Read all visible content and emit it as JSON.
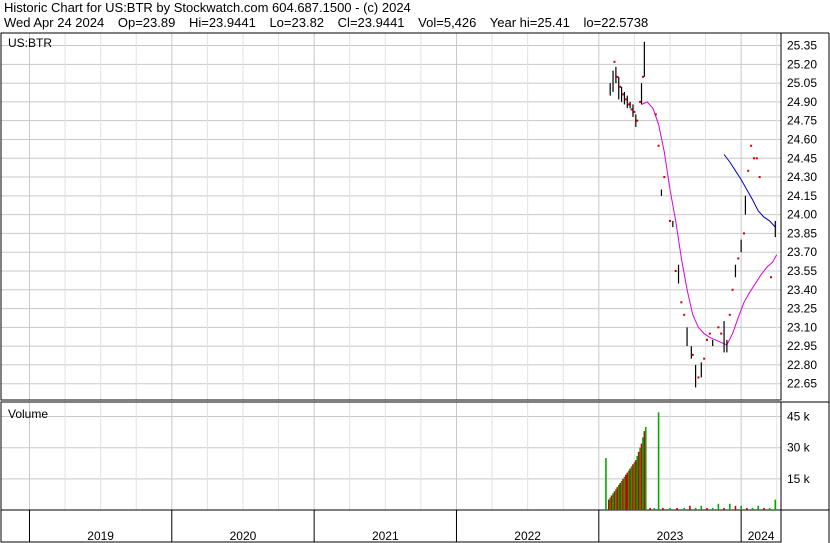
{
  "header": {
    "title": "Historic Chart for US:BTR by Stockwatch.com 604.687.1500 - (c) 2024",
    "date": "Wed Apr 24 2024",
    "open": "Op=23.89",
    "high": "Hi=23.9441",
    "low": "Lo=23.82",
    "close": "Cl=23.9441",
    "volume": "Vol=5,426",
    "year_high": "Year hi=25.41",
    "year_low": "lo=22.5738"
  },
  "price_panel": {
    "label": "US:BTR"
  },
  "volume_panel": {
    "label": "Volume"
  },
  "colors": {
    "price_bar": "#000000",
    "price_dot": "#cc0000",
    "ma_short": "#dd00dd",
    "ma_long": "#0000cc",
    "vol_up": "#00aa00",
    "vol_down": "#cc0000",
    "grid": "#c8c8c8"
  },
  "chart_data": [
    {
      "type": "line",
      "title": "US:BTR",
      "y_ticks": [
        25.35,
        25.2,
        25.05,
        24.9,
        24.75,
        24.6,
        24.45,
        24.3,
        24.15,
        24.0,
        23.85,
        23.7,
        23.55,
        23.4,
        23.25,
        23.1,
        22.95,
        22.8,
        22.65
      ],
      "ylim": [
        22.52,
        25.45
      ],
      "x_labels": [
        "2019",
        "2020",
        "2021",
        "2022",
        "2023",
        "2024"
      ],
      "price_bars": [
        {
          "t": 2023.08,
          "high": 25.05,
          "low": 24.95
        },
        {
          "t": 2023.1,
          "high": 25.15,
          "low": 24.98
        },
        {
          "t": 2023.12,
          "high": 25.18,
          "low": 25.05
        },
        {
          "t": 2023.14,
          "high": 25.1,
          "low": 24.92
        },
        {
          "t": 2023.16,
          "high": 25.02,
          "low": 24.9
        },
        {
          "t": 2023.18,
          "high": 24.98,
          "low": 24.88
        },
        {
          "t": 2023.2,
          "high": 24.95,
          "low": 24.85
        },
        {
          "t": 2023.22,
          "high": 24.9,
          "low": 24.85
        },
        {
          "t": 2023.24,
          "high": 24.88,
          "low": 24.78
        },
        {
          "t": 2023.26,
          "high": 24.8,
          "low": 24.7
        },
        {
          "t": 2023.3,
          "high": 25.05,
          "low": 24.88
        },
        {
          "t": 2023.32,
          "high": 25.38,
          "low": 25.1
        },
        {
          "t": 2023.44,
          "high": 24.2,
          "low": 24.15
        },
        {
          "t": 2023.52,
          "high": 23.95,
          "low": 23.9
        },
        {
          "t": 2023.56,
          "high": 23.6,
          "low": 23.45
        },
        {
          "t": 2023.62,
          "high": 23.1,
          "low": 22.95
        },
        {
          "t": 2023.65,
          "high": 22.95,
          "low": 22.85
        },
        {
          "t": 2023.68,
          "high": 22.8,
          "low": 22.62
        },
        {
          "t": 2023.72,
          "high": 22.82,
          "low": 22.7
        },
        {
          "t": 2023.8,
          "high": 23.0,
          "low": 22.95
        },
        {
          "t": 2023.88,
          "high": 23.15,
          "low": 22.9
        },
        {
          "t": 2023.9,
          "high": 23.0,
          "low": 22.9
        },
        {
          "t": 2023.96,
          "high": 23.6,
          "low": 23.5
        },
        {
          "t": 2024.0,
          "high": 23.8,
          "low": 23.7
        },
        {
          "t": 2024.03,
          "high": 24.15,
          "low": 24.0
        },
        {
          "t": 2024.24,
          "high": 23.95,
          "low": 23.82
        }
      ],
      "price_dots": [
        {
          "t": 2023.11,
          "v": 25.22
        },
        {
          "t": 2023.13,
          "v": 25.1
        },
        {
          "t": 2023.15,
          "v": 25.02
        },
        {
          "t": 2023.17,
          "v": 24.96
        },
        {
          "t": 2023.19,
          "v": 24.92
        },
        {
          "t": 2023.21,
          "v": 24.88
        },
        {
          "t": 2023.23,
          "v": 24.84
        },
        {
          "t": 2023.25,
          "v": 24.82
        },
        {
          "t": 2023.27,
          "v": 24.75
        },
        {
          "t": 2023.29,
          "v": 24.9
        },
        {
          "t": 2023.31,
          "v": 25.1
        },
        {
          "t": 2023.4,
          "v": 24.8
        },
        {
          "t": 2023.42,
          "v": 24.55
        },
        {
          "t": 2023.46,
          "v": 24.3
        },
        {
          "t": 2023.5,
          "v": 23.95
        },
        {
          "t": 2023.54,
          "v": 23.55
        },
        {
          "t": 2023.58,
          "v": 23.3
        },
        {
          "t": 2023.6,
          "v": 23.2
        },
        {
          "t": 2023.66,
          "v": 22.88
        },
        {
          "t": 2023.7,
          "v": 22.7
        },
        {
          "t": 2023.74,
          "v": 22.85
        },
        {
          "t": 2023.76,
          "v": 23.0
        },
        {
          "t": 2023.78,
          "v": 23.05
        },
        {
          "t": 2023.84,
          "v": 23.1
        },
        {
          "t": 2023.86,
          "v": 23.05
        },
        {
          "t": 2023.92,
          "v": 23.2
        },
        {
          "t": 2023.94,
          "v": 23.4
        },
        {
          "t": 2023.98,
          "v": 23.65
        },
        {
          "t": 2024.02,
          "v": 23.85
        },
        {
          "t": 2024.05,
          "v": 24.35
        },
        {
          "t": 2024.07,
          "v": 24.55
        },
        {
          "t": 2024.09,
          "v": 24.45
        },
        {
          "t": 2024.11,
          "v": 24.45
        },
        {
          "t": 2024.13,
          "v": 24.3
        },
        {
          "t": 2024.21,
          "v": 23.5
        }
      ],
      "series": [
        {
          "key": "ma_short",
          "points": [
            {
              "t": 2023.3,
              "v": 24.88
            },
            {
              "t": 2023.34,
              "v": 24.9
            },
            {
              "t": 2023.38,
              "v": 24.85
            },
            {
              "t": 2023.42,
              "v": 24.72
            },
            {
              "t": 2023.46,
              "v": 24.5
            },
            {
              "t": 2023.5,
              "v": 24.2
            },
            {
              "t": 2023.54,
              "v": 23.95
            },
            {
              "t": 2023.58,
              "v": 23.65
            },
            {
              "t": 2023.62,
              "v": 23.4
            },
            {
              "t": 2023.66,
              "v": 23.2
            },
            {
              "t": 2023.7,
              "v": 23.1
            },
            {
              "t": 2023.74,
              "v": 23.05
            },
            {
              "t": 2023.78,
              "v": 23.02
            },
            {
              "t": 2023.82,
              "v": 23.0
            },
            {
              "t": 2023.86,
              "v": 22.98
            },
            {
              "t": 2023.9,
              "v": 22.96
            },
            {
              "t": 2023.94,
              "v": 23.05
            },
            {
              "t": 2023.98,
              "v": 23.18
            },
            {
              "t": 2024.02,
              "v": 23.3
            },
            {
              "t": 2024.06,
              "v": 23.38
            },
            {
              "t": 2024.1,
              "v": 23.45
            },
            {
              "t": 2024.14,
              "v": 23.52
            },
            {
              "t": 2024.18,
              "v": 23.58
            },
            {
              "t": 2024.22,
              "v": 23.62
            },
            {
              "t": 2024.25,
              "v": 23.68
            }
          ]
        },
        {
          "key": "ma_long",
          "points": [
            {
              "t": 2023.88,
              "v": 24.48
            },
            {
              "t": 2023.92,
              "v": 24.42
            },
            {
              "t": 2023.96,
              "v": 24.35
            },
            {
              "t": 2024.0,
              "v": 24.28
            },
            {
              "t": 2024.04,
              "v": 24.2
            },
            {
              "t": 2024.08,
              "v": 24.12
            },
            {
              "t": 2024.12,
              "v": 24.03
            },
            {
              "t": 2024.16,
              "v": 23.98
            },
            {
              "t": 2024.2,
              "v": 23.95
            },
            {
              "t": 2024.24,
              "v": 23.9
            }
          ]
        }
      ]
    },
    {
      "type": "bar",
      "title": "Volume",
      "y_ticks": [
        15,
        30,
        45
      ],
      "y_tick_labels": [
        "15 k",
        "30 k",
        "45 k"
      ],
      "ylim": [
        0,
        52
      ],
      "values_unit": "thousands",
      "bars": [
        {
          "t": 2023.05,
          "v": 25,
          "up": true
        },
        {
          "t": 2023.07,
          "v": 5,
          "up": false
        },
        {
          "t": 2023.08,
          "v": 6,
          "up": true
        },
        {
          "t": 2023.09,
          "v": 7,
          "up": false
        },
        {
          "t": 2023.1,
          "v": 8,
          "up": true
        },
        {
          "t": 2023.11,
          "v": 9,
          "up": false
        },
        {
          "t": 2023.12,
          "v": 10,
          "up": true
        },
        {
          "t": 2023.13,
          "v": 11,
          "up": false
        },
        {
          "t": 2023.14,
          "v": 12,
          "up": true
        },
        {
          "t": 2023.15,
          "v": 13,
          "up": false
        },
        {
          "t": 2023.16,
          "v": 14,
          "up": true
        },
        {
          "t": 2023.17,
          "v": 15,
          "up": false
        },
        {
          "t": 2023.18,
          "v": 16,
          "up": true
        },
        {
          "t": 2023.19,
          "v": 17,
          "up": false
        },
        {
          "t": 2023.2,
          "v": 18,
          "up": false
        },
        {
          "t": 2023.21,
          "v": 19,
          "up": true
        },
        {
          "t": 2023.22,
          "v": 20,
          "up": false
        },
        {
          "t": 2023.23,
          "v": 21,
          "up": true
        },
        {
          "t": 2023.24,
          "v": 22,
          "up": false
        },
        {
          "t": 2023.25,
          "v": 23,
          "up": true
        },
        {
          "t": 2023.26,
          "v": 24,
          "up": false
        },
        {
          "t": 2023.27,
          "v": 26,
          "up": true
        },
        {
          "t": 2023.28,
          "v": 28,
          "up": false
        },
        {
          "t": 2023.29,
          "v": 30,
          "up": true
        },
        {
          "t": 2023.3,
          "v": 32,
          "up": false
        },
        {
          "t": 2023.31,
          "v": 35,
          "up": true
        },
        {
          "t": 2023.32,
          "v": 38,
          "up": false
        },
        {
          "t": 2023.33,
          "v": 40,
          "up": true
        },
        {
          "t": 2023.36,
          "v": 1,
          "up": false
        },
        {
          "t": 2023.39,
          "v": 1,
          "up": true
        },
        {
          "t": 2023.42,
          "v": 47,
          "up": true
        },
        {
          "t": 2023.45,
          "v": 1,
          "up": false
        },
        {
          "t": 2023.5,
          "v": 1,
          "up": true
        },
        {
          "t": 2023.55,
          "v": 1,
          "up": false
        },
        {
          "t": 2023.6,
          "v": 1,
          "up": true
        },
        {
          "t": 2023.64,
          "v": 2,
          "up": false
        },
        {
          "t": 2023.68,
          "v": 1,
          "up": true
        },
        {
          "t": 2023.72,
          "v": 2,
          "up": true
        },
        {
          "t": 2023.76,
          "v": 1,
          "up": false
        },
        {
          "t": 2023.8,
          "v": 1,
          "up": true
        },
        {
          "t": 2023.84,
          "v": 3,
          "up": true
        },
        {
          "t": 2023.88,
          "v": 1,
          "up": false
        },
        {
          "t": 2023.92,
          "v": 3,
          "up": true
        },
        {
          "t": 2023.96,
          "v": 2,
          "up": false
        },
        {
          "t": 2024.0,
          "v": 2,
          "up": true
        },
        {
          "t": 2024.04,
          "v": 1,
          "up": false
        },
        {
          "t": 2024.08,
          "v": 1,
          "up": true
        },
        {
          "t": 2024.12,
          "v": 2,
          "up": true
        },
        {
          "t": 2024.16,
          "v": 1,
          "up": false
        },
        {
          "t": 2024.2,
          "v": 1,
          "up": true
        },
        {
          "t": 2024.24,
          "v": 5,
          "up": true
        }
      ]
    }
  ]
}
